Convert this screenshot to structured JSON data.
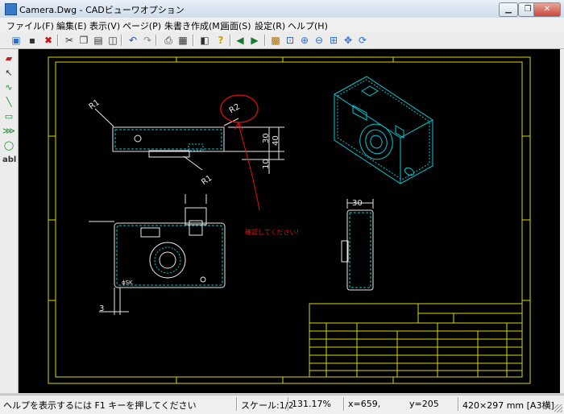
{
  "window": {
    "title": "Camera.Dwg - CADビューワオプション"
  },
  "menu": [
    "ファイル(F)",
    "編集(E)",
    "表示(V)",
    "ページ(P)",
    "朱書き作成(M)",
    "画面(S)",
    "設定(R)",
    "ヘルプ(H)"
  ],
  "drawing": {
    "dims": {
      "r1_top": "R1",
      "r2": "R2",
      "r1_bottom": "R1",
      "d30": "30",
      "d40": "40",
      "d10": "10",
      "d30_side": "30",
      "d3": "3"
    },
    "annotation": "確認してください！",
    "brand_mark": "ɸSK"
  },
  "status": {
    "help": "ヘルプを表示するには F1 キーを押してください",
    "scale": "スケール:1/2",
    "zoom": "131.17%",
    "x": "x=659,",
    "y": "y=205",
    "paper": "420×297 mm [A3横]"
  },
  "colors": {
    "drawing_frame": "#d8d800",
    "outline": "#e8e8e8",
    "detail": "#00c8d0",
    "markup_red": "#e01010",
    "canvas_bg": "#000000"
  }
}
